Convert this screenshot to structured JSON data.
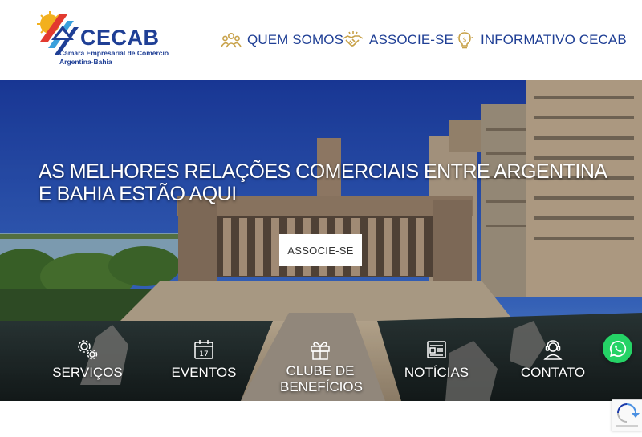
{
  "logo": {
    "name": "CECAB",
    "subtitle_line1": "Câmara Empresarial de Comércio",
    "subtitle_line2": "Argentina-Bahia"
  },
  "nav": {
    "items": [
      {
        "label": "QUEM SOMOS",
        "icon": "team-icon"
      },
      {
        "label": "ASSOCIE-SE",
        "icon": "handshake-icon"
      },
      {
        "label": "INFORMATIVO CECAB",
        "icon": "lightbulb-icon"
      }
    ]
  },
  "hero": {
    "title": "AS MELHORES RELAÇÕES COMERCIAIS ENTRE ARGENTINA E BAHIA ESTÃO AQUI",
    "cta_label": "ASSOCIE-SE"
  },
  "quick_links": [
    {
      "label": "SERVIÇOS",
      "icon": "gears-icon"
    },
    {
      "label": "EVENTOS",
      "icon": "calendar-icon"
    },
    {
      "label": "CLUBE DE BENEFÍCIOS",
      "icon": "gift-icon"
    },
    {
      "label": "NOTÍCIAS",
      "icon": "newspaper-icon"
    },
    {
      "label": "CONTATO",
      "icon": "support-agent-icon"
    }
  ],
  "colors": {
    "brand_blue": "#1f3f95",
    "nav_icon_gold": "#c8a24a",
    "whatsapp_green": "#25d366"
  }
}
